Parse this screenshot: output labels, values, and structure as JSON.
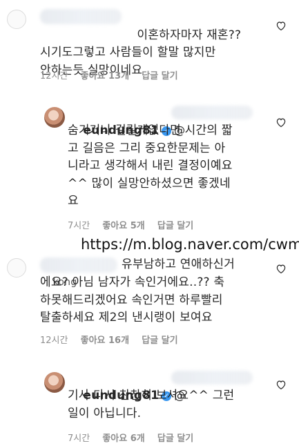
{
  "comments": [
    {
      "id": "c1",
      "text": "이혼하자마자 재혼??\n시기도그렇고 사람들이 할말 많지만\n안하는듯 실망이네요",
      "time": "12시간",
      "likes": "좋아요 13개",
      "reply": "답글 달기",
      "icon": "heart-outline-icon"
    },
    {
      "id": "r1",
      "username": "eundung81",
      "mention_prefix": "@",
      "text": "숨기거나 걸릴게없다면 시간의 짧\n고 길음은 그리 중요한문제는 아\n니라고 생각해서 내린 결정이예요\n^^ 많이 실망안하셨으면 좋겠네\n요",
      "time": "7시간",
      "likes": "좋아요 5개",
      "reply": "답글 달기",
      "icon": "heart-outline-icon"
    },
    {
      "id": "c2",
      "username_partial": "kong",
      "text_line1": "유부남하고 연애하신거",
      "text": "에요? 아님 남자가 속인거에요..?? 축\n하못해드리겠어요 속인거면 하루빨리\n탈출하세요 제2의 낸시랭이 보여요",
      "time": "12시간",
      "likes": "좋아요 16개",
      "reply": "답글 달기",
      "icon": "heart-outline-icon"
    },
    {
      "id": "r2",
      "username": "eundung81",
      "mention_prefix": "@",
      "text": "기사 다시 찬찬히 보셔요^^ 그런\n일이 아닙니다.",
      "time": "7시간",
      "likes": "좋아요 6개",
      "reply": "답글 달기",
      "icon": "heart-outline-icon"
    }
  ],
  "watermark": "https://m.blog.naver.com/cwm",
  "verified_icon": "verified-badge-icon",
  "colors": {
    "meta": "#8e8e8e",
    "text": "#262626",
    "verified": "#3897f0"
  }
}
